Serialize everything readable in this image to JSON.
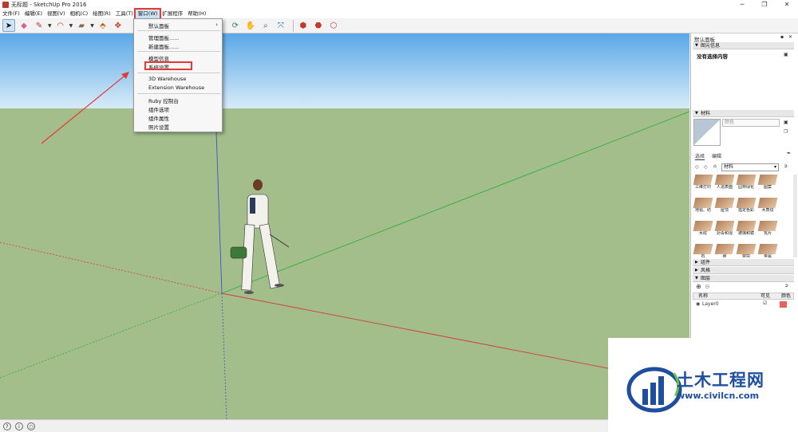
{
  "window": {
    "title": "无标题 - SketchUp Pro 2016"
  },
  "menubar": {
    "items": [
      "文件(F)",
      "编辑(E)",
      "视图(V)",
      "相机(C)",
      "绘图(R)",
      "工具(T)",
      "窗口(W)",
      "扩展程序",
      "帮助(H)"
    ],
    "active_index": 6
  },
  "window_menu": {
    "items": [
      "默认面板",
      "管理面板......",
      "新建面板......",
      "模型信息",
      "系统设置",
      "3D Warehouse",
      "Extension Warehouse",
      "Ruby 控制台",
      "组件选项",
      "组件属性",
      "照片设置"
    ],
    "highlighted_index": 4,
    "submenu_caret": "›"
  },
  "panel": {
    "title": "默认面板",
    "entity_info": {
      "header": "图元信息",
      "status": "没有选择内容"
    },
    "materials": {
      "header": "材料",
      "name_placeholder": "颜色",
      "tab_select": "选择",
      "tab_edit": "编辑",
      "library": "材料",
      "swatches": [
        "三维打印",
        "人造表面",
        "园林绿化",
        "图案",
        "地毯、纺",
        "屋顶",
        "指定色彩",
        "木质纹",
        "水纹",
        "沥青和混",
        "玻璃和镜",
        "瓦片",
        "石",
        "砖",
        "窗帘",
        "金属"
      ]
    },
    "collapsed": [
      "组件",
      "风格"
    ],
    "layers": {
      "header": "图层",
      "columns": [
        "名称",
        "可见",
        "颜色"
      ],
      "rows": [
        {
          "name": "Layer0",
          "visible": true,
          "color": "#e8625c"
        }
      ]
    }
  },
  "watermark": {
    "brand": "土木工程网",
    "url": "www.civilcn.com"
  },
  "colors": {
    "menu_highlight": "#e53935",
    "sky": "#5aa8e8",
    "ground": "#a3be8b",
    "axis_red": "#d23a3a",
    "axis_green": "#2fae3e",
    "axis_blue": "#3a56c8"
  }
}
